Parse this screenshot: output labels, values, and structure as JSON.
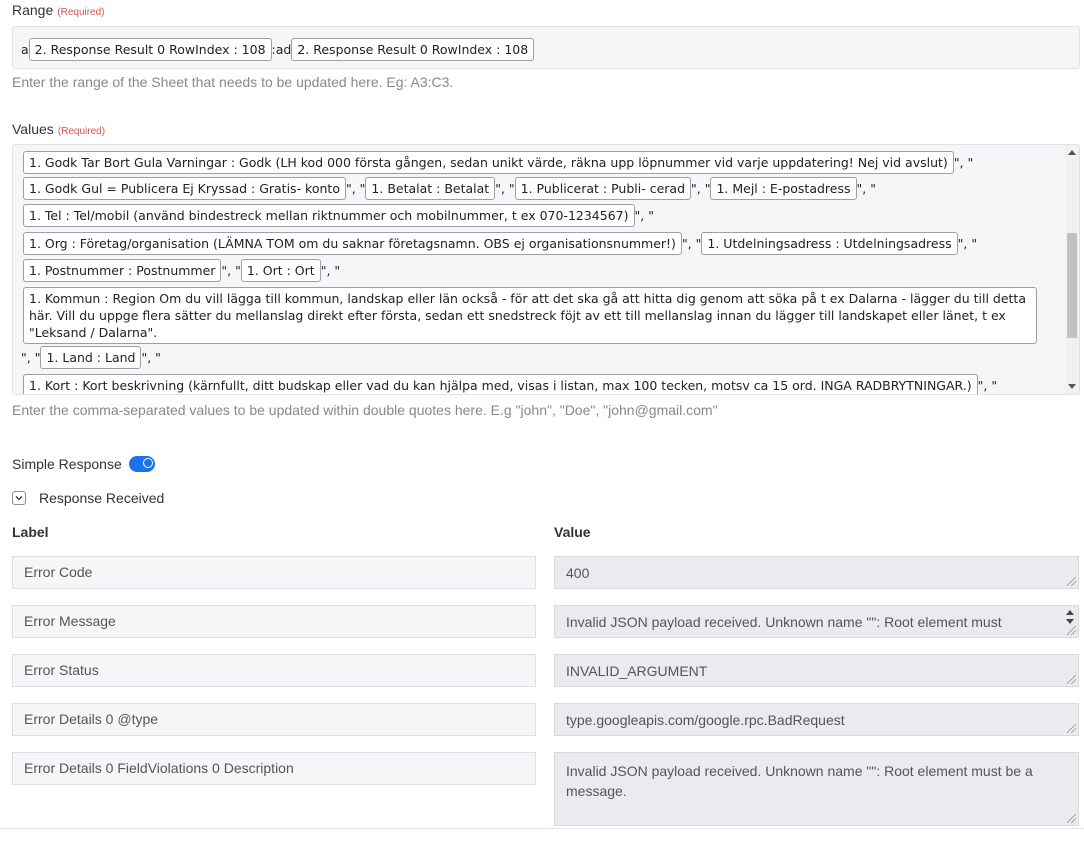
{
  "range": {
    "label": "Range",
    "required": "(Required)",
    "prefix": "a",
    "pill1": "2. Response Result 0 RowIndex : 108",
    "middle": ":ad",
    "pill2": "2. Response Result 0 RowIndex : 108",
    "hint": "Enter the range of the Sheet that needs to be updated here. Eg: A3:C3."
  },
  "values": {
    "label": "Values",
    "required": "(Required)",
    "hint": "Enter the comma-separated values to be updated within double quotes here. E.g \"john\", \"Doe\", \"john@gmail.com\"",
    "sep": "\", \"",
    "tokens": {
      "godk": "1. Godk Tar Bort Gula Varningar : Godk (LH kod 000 första gången, sedan unikt värde, räkna upp löpnummer vid varje uppdatering! Nej vid avslut)",
      "gul": "1. Godk Gul = Publicera Ej Kryssad : Gratis- konto",
      "betalat": "1. Betalat : Betalat",
      "publicerat": "1. Publicerat : Publi- cerad",
      "mejl": "1. Mejl : E-postadress",
      "tel": "1. Tel : Tel/mobil (använd bindestreck mellan riktnummer och mobilnummer, t ex 070-1234567)",
      "org": "1. Org : Företag/organisation (LÄMNA TOM om du saknar företagsnamn. OBS ej organisationsnummer!)",
      "utdelning": "1. Utdelningsadress : Utdelningsadress",
      "postnummer": "1. Postnummer : Postnummer",
      "ort": "1. Ort : Ort",
      "kommun": "1. Kommun : Region Om du vill lägga till kommun, landskap eller län också - för att det ska gå att hitta dig genom att söka på t ex Dalarna - lägger du till detta här. Vill du uppge flera sätter du mellanslag direkt efter första, sedan ett snedstreck föjt av ett till mellanslag innan du lägger till landskapet eller länet, t ex \"Leksand / Dalarna\".",
      "land": "1. Land : Land",
      "kort": "1. Kort : Kort beskrivning (kärnfullt, ditt budskap eller vad du kan hjälpa med, visas i listan, max 100 tecken, motsv ca 15 ord. INGA RADBRYTNINGAR.)"
    }
  },
  "simple_response": {
    "label": "Simple Response",
    "enabled": true
  },
  "response_received": {
    "label": "Response Received"
  },
  "columns": {
    "label": "Label",
    "value": "Value"
  },
  "rows": [
    {
      "label": "Error Code",
      "value": "400"
    },
    {
      "label": "Error Message",
      "value": "Invalid JSON payload received. Unknown name \"\": Root element must"
    },
    {
      "label": "Error Status",
      "value": "INVALID_ARGUMENT"
    },
    {
      "label": "Error Details 0 @type",
      "value": "type.googleapis.com/google.rpc.BadRequest"
    },
    {
      "label": "Error Details 0 FieldViolations 0 Description",
      "value": "Invalid JSON payload received. Unknown name \"\": Root element must be a message."
    }
  ]
}
